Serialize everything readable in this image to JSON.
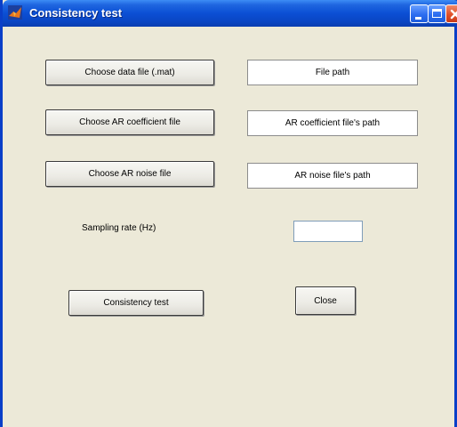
{
  "window": {
    "title": "Consistency test",
    "icon": "matlab-figure-icon",
    "title_bar_color": "#0a46c4",
    "background_color": "#ece9d8"
  },
  "buttons": {
    "choose_data_file": "Choose data file (.mat)",
    "choose_ar_coefficient_file": "Choose AR coefficient file",
    "choose_ar_noise_file": "Choose AR noise file",
    "consistency_test": "Consistency test",
    "close": "Close"
  },
  "paths": {
    "data_file": "File path",
    "ar_coefficient_file": "AR coefficient file's path",
    "ar_noise_file": "AR noise file's path"
  },
  "sampling_rate": {
    "label": "Sampling rate (Hz)",
    "value": ""
  }
}
